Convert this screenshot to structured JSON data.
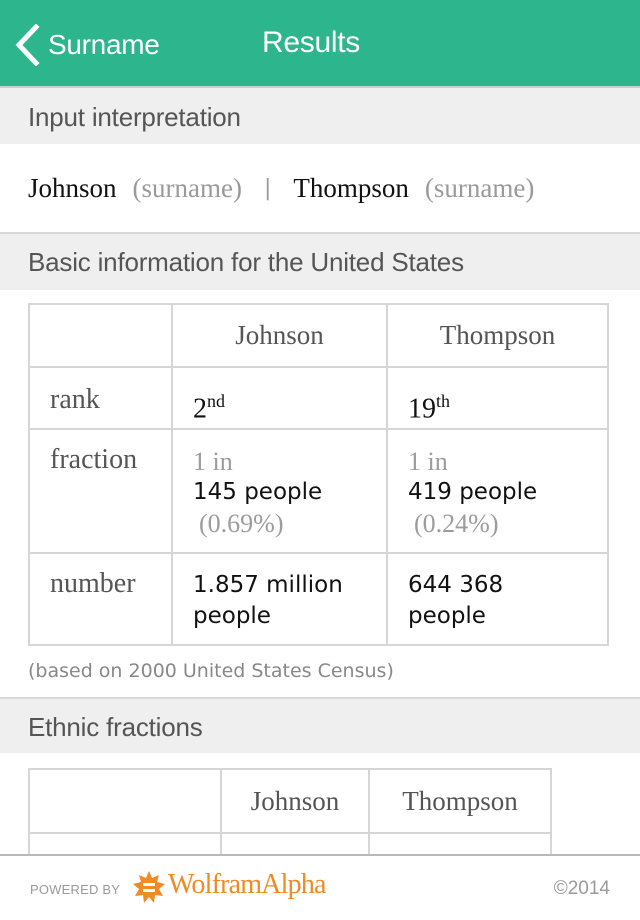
{
  "nav": {
    "back_label": "Surname",
    "title": "Results",
    "accent_color": "#2db68d"
  },
  "pods": {
    "input_interpretation": {
      "title": "Input interpretation",
      "items": [
        {
          "name": "Johnson",
          "type": "(surname)"
        },
        {
          "name": "Thompson",
          "type": "(surname)"
        }
      ],
      "separator": "|"
    },
    "basic_info": {
      "title": "Basic information for the United States",
      "columns": [
        "",
        "Johnson",
        "Thompson"
      ],
      "rows": {
        "rank": {
          "label": "rank",
          "johnson": {
            "value": "2",
            "suffix": "nd"
          },
          "thompson": {
            "value": "19",
            "suffix": "th"
          }
        },
        "fraction": {
          "label": "fraction",
          "johnson": {
            "prefix": "1 in",
            "value": "145 people",
            "percent": "(0.69%)"
          },
          "thompson": {
            "prefix": "1 in",
            "value": "419 people",
            "percent": "(0.24%)"
          }
        },
        "number": {
          "label": "number",
          "johnson": {
            "line1": "1.857 million",
            "line2": "people"
          },
          "thompson": {
            "line1": "644 368",
            "line2": "people"
          }
        }
      },
      "note": "(based on 2000 United States Census)"
    },
    "ethnic_fractions": {
      "title": "Ethnic fractions",
      "columns": [
        "",
        "Johnson",
        "Thompson"
      ]
    }
  },
  "footer": {
    "powered_by": "POWERED BY",
    "brand": "WolframAlpha",
    "brand_color": "#f08a24",
    "copyright": "©2014"
  }
}
